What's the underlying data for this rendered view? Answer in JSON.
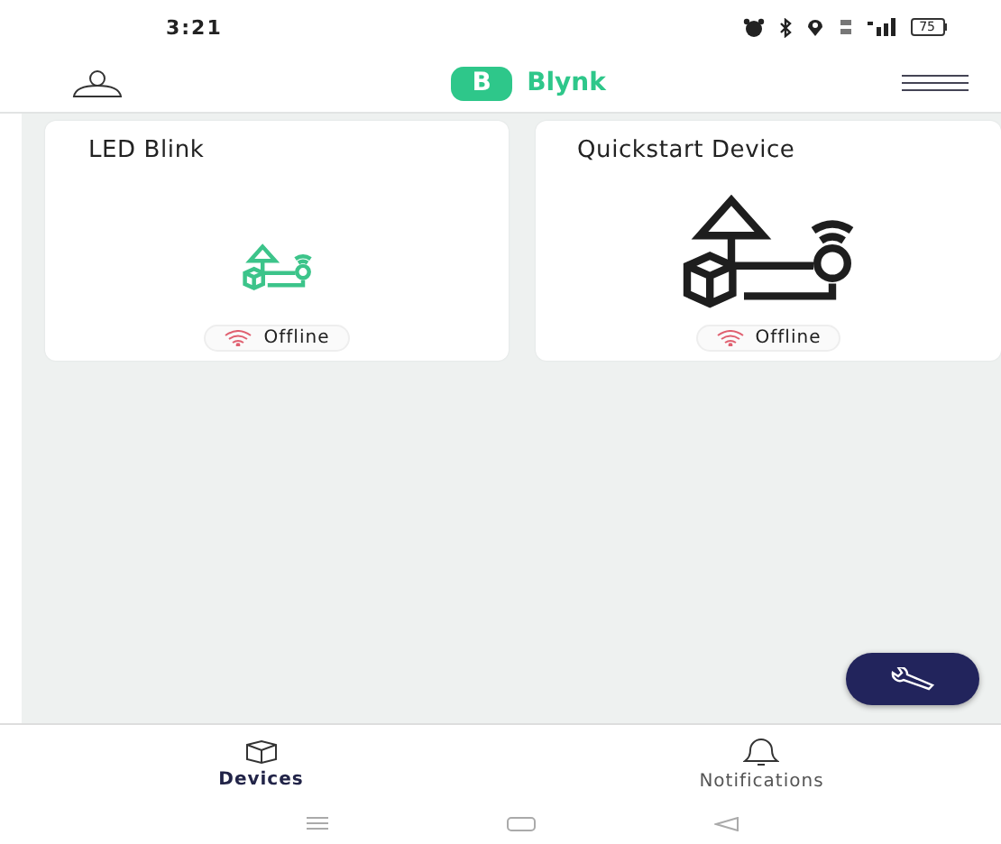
{
  "status_bar": {
    "time": "3:21",
    "battery": "75"
  },
  "header": {
    "logo_letter": "B",
    "title": "Blynk"
  },
  "devices": [
    {
      "name": "LED Blink",
      "kind": "small",
      "color": "#3cc48a",
      "status": "Offline"
    },
    {
      "name": "Quickstart Device",
      "kind": "large",
      "color": "#1e1e1e",
      "status": "Offline"
    }
  ],
  "tabs": [
    {
      "label": "Devices",
      "selected": true
    },
    {
      "label": "Notifications",
      "selected": false
    }
  ]
}
